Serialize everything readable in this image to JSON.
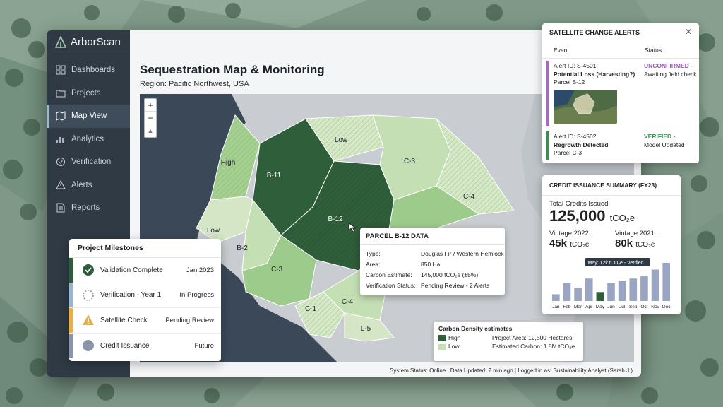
{
  "app": {
    "brand": "ArborScan"
  },
  "sidebar": {
    "items": [
      {
        "label": "Dashboards",
        "icon": "dashboard-icon"
      },
      {
        "label": "Projects",
        "icon": "folder-icon"
      },
      {
        "label": "Map View",
        "icon": "map-icon",
        "active": true
      },
      {
        "label": "Analytics",
        "icon": "chart-icon"
      },
      {
        "label": "Verification",
        "icon": "check-circle-icon"
      },
      {
        "label": "Alerts",
        "icon": "warning-icon"
      },
      {
        "label": "Reports",
        "icon": "document-icon"
      }
    ]
  },
  "page": {
    "title": "Sequestration Map & Monitoring",
    "region": "Region: Pacific Northwest, USA"
  },
  "map": {
    "zoom_in": "+",
    "zoom_out": "−",
    "parcels": [
      "High",
      "B-11",
      "Low",
      "C-3",
      "C-4",
      "B-12",
      "Low",
      "B-2",
      "C-3",
      "C-1",
      "C-4",
      "L-5"
    ],
    "colors": {
      "high": "#2f5e3a",
      "low": "#c5dfb4",
      "mid": "#9ccb8b",
      "water": "#3a4858"
    }
  },
  "parcel_tip": {
    "title": "PARCEL B-12 DATA",
    "rows": [
      {
        "k": "Type:",
        "v": "Douglas Fir / Western Hemlock"
      },
      {
        "k": "Area:",
        "v": "850 Ha"
      },
      {
        "k": "Carbon Estimate:",
        "v": "145,000 tCO₂e (±5%)"
      },
      {
        "k": "Verification Status:",
        "v": "Pending Review - 2 Alerts"
      }
    ]
  },
  "legend": {
    "title": "Carbon Density estimates",
    "high": "High",
    "low": "Low",
    "area": "Project Area: 12,500 Hectares",
    "carbon": "Estimated Carbon: 1.8M tCO₂e"
  },
  "status_bar": "System Status: Online | Data Updated: 2 min ago | Logged in as: Sustainability Analyst (Sarah J.)",
  "milestones": {
    "title": "Project Milestones",
    "items": [
      {
        "label": "Validation Complete",
        "value": "Jan 2023",
        "color": "#2f5e3a",
        "icon": "check-circle-icon"
      },
      {
        "label": "Verification - Year 1",
        "value": "In Progress",
        "color": "#9ab6d0",
        "icon": "spinner-icon"
      },
      {
        "label": "Satellite Check",
        "value": "Pending Review",
        "color": "#e8b04a",
        "icon": "warning-icon"
      },
      {
        "label": "Credit Issuance",
        "value": "Future",
        "color": "#8a94ab",
        "icon": "circle-icon"
      }
    ]
  },
  "alerts": {
    "title": "SATELLITE CHANGE ALERTS",
    "col_event": "Event",
    "col_status": "Status",
    "items": [
      {
        "id": "Alert ID: S-4501",
        "event": "Potential Loss (Harvesting?)",
        "parcel": "Parcel B-12",
        "status": "UNCONFIRMED",
        "status_rest": " -",
        "status_note": "Awaiting field check",
        "color": "#a46cc0"
      },
      {
        "id": "Alert ID: S-4502",
        "event": "Regrowth Detected",
        "parcel": "Parcel C-3",
        "status": "VERIFIED",
        "status_rest": " -",
        "status_note": "Model Updated",
        "color": "#3f8b55"
      }
    ]
  },
  "credit": {
    "title": "CREDIT ISSUANCE SUMMARY (FY23)",
    "total_label": "Total Credits Issued:",
    "total_value": "125,000",
    "unit": "tCO₂e",
    "v2022_label": "Vintage 2022:",
    "v2022_value": "45k",
    "v2021_label": "Vintage 2021:",
    "v2021_value": "80k",
    "tooltip": "May: 12k tCO₂e - Verified"
  },
  "chart_data": {
    "type": "bar",
    "categories": [
      "Jan",
      "Feb",
      "Mar",
      "Apr",
      "May",
      "Jun",
      "Jul",
      "Sep",
      "Oct",
      "Nov",
      "Dec"
    ],
    "values": [
      3,
      8,
      6,
      10,
      4,
      8,
      9,
      10,
      11,
      14,
      17
    ],
    "highlight": "May",
    "colors": {
      "bar": "#9aa5c4",
      "highlight": "#2f5e3a"
    }
  }
}
